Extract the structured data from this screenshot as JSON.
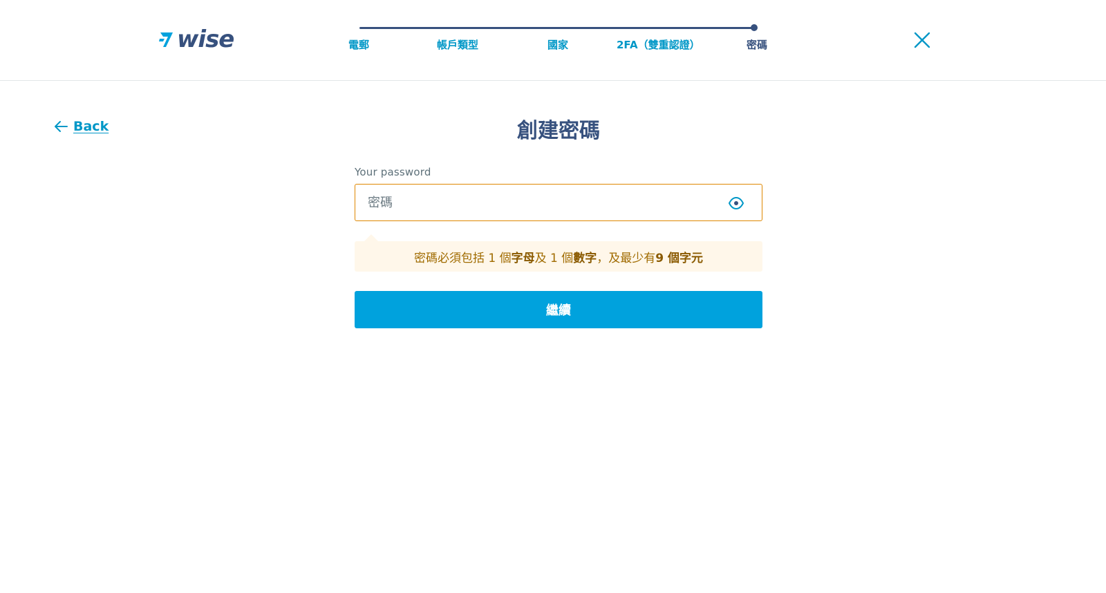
{
  "brand": {
    "logo_text": "wise"
  },
  "stepper": {
    "steps": [
      {
        "label": "電郵"
      },
      {
        "label": "帳戶類型"
      },
      {
        "label": "國家"
      },
      {
        "label": "2FA（雙重認證）"
      },
      {
        "label": "密碼"
      }
    ],
    "current_step": 5,
    "total_steps": 5
  },
  "nav": {
    "back_label": "Back"
  },
  "form": {
    "title": "創建密碼",
    "password_label": "Your password",
    "password_placeholder": "密碼",
    "password_value": "",
    "hint": {
      "part1": "密碼必須包括 1 個",
      "bold1": "字母",
      "part2": "及 1 個",
      "bold2": "數字",
      "part3": "，及最少有",
      "bold3": "9 個字元"
    },
    "continue_label": "繼續"
  },
  "colors": {
    "brand_navy": "#37517e",
    "accent_blue": "#00a2dd",
    "link_blue": "#0097c7",
    "warning_border": "#df8700",
    "hint_bg": "#fff7ea",
    "hint_text": "#a06b00"
  },
  "icons": {
    "logo": "wise-flag-icon",
    "close": "close-icon",
    "back": "arrow-left-icon",
    "show_password": "eye-icon"
  }
}
